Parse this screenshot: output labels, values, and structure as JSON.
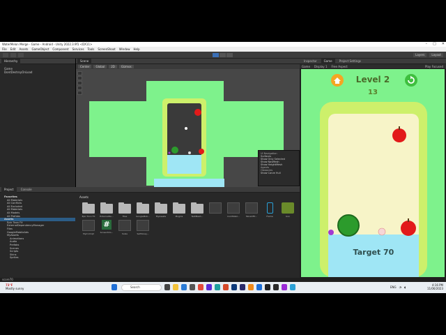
{
  "window": {
    "title": "WaterMelon Merge - Game - Android - Unity 2022.3.9f1 <DX11>"
  },
  "menu": [
    "File",
    "Edit",
    "Assets",
    "GameObject",
    "Component",
    "Services",
    "Tools",
    "ScreenShoot",
    "Window",
    "Help"
  ],
  "toolbar": {
    "layers": "Layers",
    "layout": "Layout"
  },
  "hierarchy": {
    "tab": "Hierarchy",
    "rows": [
      "Game",
      "DontDestroyOnLoad"
    ]
  },
  "scene": {
    "tab": "Scene",
    "tools": [
      "Center",
      "Global",
      "2D",
      "Gizmos"
    ],
    "overlay_menu": [
      "UI Navigation",
      "Surfaces",
      "Show Only Selected",
      "Show NavMesh",
      "Show HeightMesh",
      "Agents",
      "Obstacles",
      "Show Carve Hull"
    ]
  },
  "project": {
    "tabs": [
      "Project",
      "Console"
    ],
    "tree": [
      {
        "t": "Favorites",
        "lvl": 0,
        "hdr": true
      },
      {
        "t": "All Materials",
        "lvl": 1
      },
      {
        "t": "All Conflicts",
        "lvl": 1
      },
      {
        "t": "All Excluded",
        "lvl": 1
      },
      {
        "t": "All Materials",
        "lvl": 1
      },
      {
        "t": "All Models",
        "lvl": 1
      },
      {
        "t": "All Prefabs",
        "lvl": 1
      },
      {
        "t": "Assets",
        "lvl": 0,
        "hdr": true,
        "sel": true
      },
      {
        "t": "Epic Toon FX",
        "lvl": 1
      },
      {
        "t": "ExternalDependencyManager",
        "lvl": 1
      },
      {
        "t": "Files",
        "lvl": 1
      },
      {
        "t": "GoogleMobileAds",
        "lvl": 1
      },
      {
        "t": "MyAssets",
        "lvl": 1
      },
      {
        "t": "Animations",
        "lvl": 2
      },
      {
        "t": "Audio",
        "lvl": 2
      },
      {
        "t": "Prefabs",
        "lvl": 2
      },
      {
        "t": "Scenes",
        "lvl": 2
      },
      {
        "t": "Scripts",
        "lvl": 2
      },
      {
        "t": "Skins",
        "lvl": 2
      },
      {
        "t": "Sprites",
        "lvl": 2
      }
    ],
    "assets_label": "Assets",
    "assets": [
      {
        "label": "Epic Toon FX",
        "kind": "folder"
      },
      {
        "label": "ExternalDe...",
        "kind": "folder"
      },
      {
        "label": "Files",
        "kind": "folder"
      },
      {
        "label": "GoogleMob...",
        "kind": "folder"
      },
      {
        "label": "MyAssets",
        "kind": "folder"
      },
      {
        "label": "Plugins",
        "kind": "folder"
      },
      {
        "label": "TextMesh...",
        "kind": "folder"
      },
      {
        "label": "",
        "kind": "file"
      },
      {
        "label": "ComMobil...",
        "kind": "file"
      },
      {
        "label": "MoreOfTr...",
        "kind": "file"
      },
      {
        "label": "Frame",
        "kind": "phone"
      },
      {
        "label": "Icon",
        "kind": "melon"
      },
      {
        "label": "MyIcnImpt",
        "kind": "file"
      },
      {
        "label": "ScreenSho...",
        "kind": "script"
      },
      {
        "label": "Scale",
        "kind": "file"
      },
      {
        "label": "SelMoney...",
        "kind": "file"
      }
    ]
  },
  "game": {
    "tabs": [
      "Inspector",
      "Game",
      "Project Settings"
    ],
    "tools": [
      "Game",
      "Display 1",
      "Free Aspect",
      "Play Focused"
    ],
    "level": "Level 2",
    "score": "13",
    "target": "Target 70",
    "colors": {
      "bg": "#7ef28c",
      "container": "#f7f4c8",
      "water": "#9fe6f5",
      "title": "#4a6b2a"
    }
  },
  "status": {
    "text": "score70"
  },
  "taskbar": {
    "weather_temp": "73°F",
    "weather_desc": "Mostly sunny",
    "search": "Search",
    "lang": "ENG",
    "time": "4:16 PM",
    "date": "11/06/2023"
  }
}
